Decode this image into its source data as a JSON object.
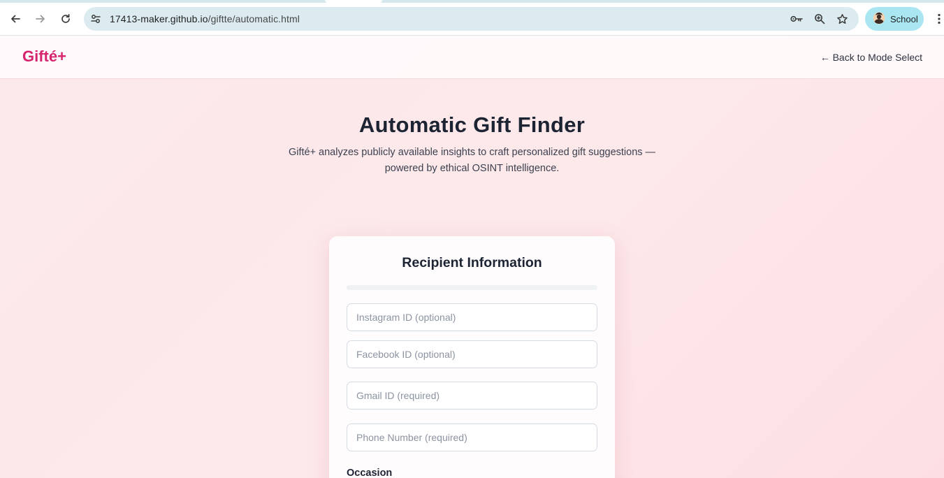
{
  "browser": {
    "url_host": "17413-maker.github.io",
    "url_path": "/giftte/automatic.html",
    "profile_label": "School",
    "icons": [
      "back-arrow-icon",
      "forward-arrow-icon",
      "reload-icon",
      "site-settings-icon",
      "password-key-icon",
      "zoom-icon",
      "bookmark-star-icon",
      "profile-avatar-icon",
      "more-menu-icon"
    ]
  },
  "header": {
    "logo": "Gifté+",
    "back_link": "← Back to Mode Select"
  },
  "hero": {
    "title": "Automatic Gift Finder",
    "subtitle": "Gifté+ analyzes publicly available insights to craft personalized gift suggestions — powered by ethical OSINT intelligence."
  },
  "form": {
    "title": "Recipient Information",
    "progress": 0,
    "fields": {
      "instagram": {
        "placeholder": "Instagram ID (optional)",
        "value": ""
      },
      "facebook": {
        "placeholder": "Facebook ID (optional)",
        "value": ""
      },
      "gmail": {
        "placeholder": "Gmail ID (required)",
        "value": ""
      },
      "phone": {
        "placeholder": "Phone Number (required)",
        "value": ""
      }
    },
    "occasion_label": "Occasion"
  },
  "colors": {
    "brand": "#d6246e",
    "page_bg": "#fde8ea",
    "text_dark": "#1c2333",
    "omnibox": "#dcebf0",
    "profile_chip": "#a9e6f2"
  }
}
